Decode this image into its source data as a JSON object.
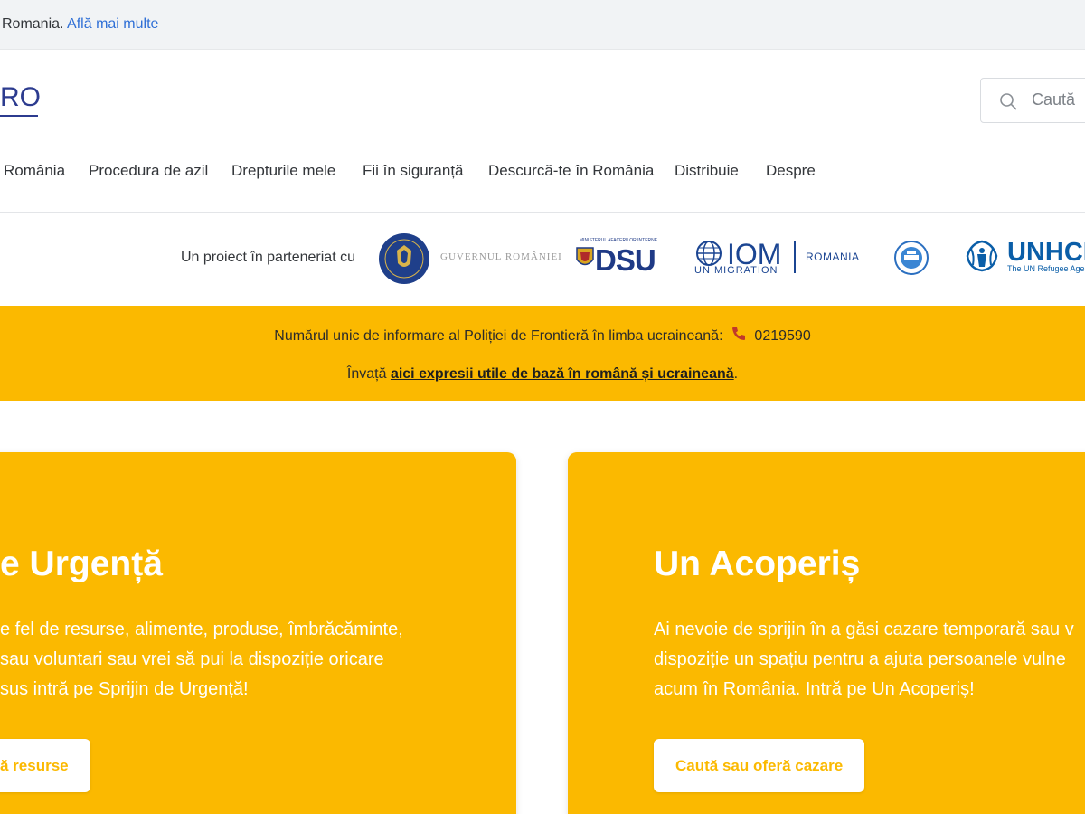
{
  "topbar": {
    "text": "Romania.",
    "link": "Află mai multe"
  },
  "header": {
    "logo": "RO",
    "search_placeholder": "Caută",
    "nav": [
      "România",
      "Procedura de azil",
      "Drepturile mele",
      "Fii în siguranță",
      "Descurcă-te în România",
      "Distribuie",
      "Despre"
    ]
  },
  "partners": {
    "label": "Un proiect în parteneriat cu",
    "gov_name": "GUVERNUL ROMÂNIEI",
    "dsu": "DSU",
    "dsu_small": "MINISTERUL AFACERILOR INTERNE",
    "iom_main": "IOM",
    "iom_sub": "UN MIGRATION",
    "iom_country": "ROMANIA",
    "unhcr_main": "UNHCR",
    "unhcr_sub": "The UN Refugee Agency"
  },
  "alert": {
    "line1_text": "Numărul unic de informare al Poliției de Frontieră în limba ucraineană:",
    "phone": "0219590",
    "line2_prefix": "Învață",
    "line2_link": "aici expresii utile de bază în română și ucraineană",
    "line2_suffix": "."
  },
  "cards": [
    {
      "title": "e Urgență",
      "lines": [
        "e fel de resurse, alimente, produse, îmbrăcăminte,",
        "sau voluntari sau vrei să pui la dispoziție oricare",
        "sus intră pe Sprijin de Urgență!"
      ],
      "button": "ă resurse"
    },
    {
      "title": "Un Acoperiș",
      "lines": [
        "Ai nevoie de sprijin în a găsi cazare temporară sau v",
        "dispoziție un spațiu pentru a ajuta persoanele vulne",
        "acum în România. Intră pe Un Acoperiș!"
      ],
      "button": "Caută sau oferă cazare"
    }
  ],
  "colors": {
    "accent": "#fbb900",
    "link": "#2f6fd6",
    "brand": "#2c3b8f"
  }
}
